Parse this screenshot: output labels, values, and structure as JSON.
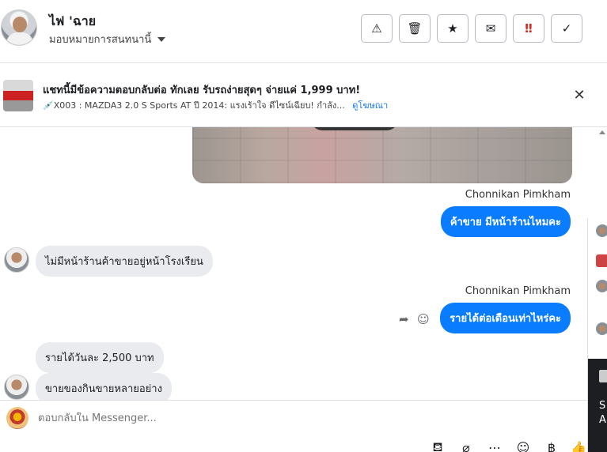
{
  "header": {
    "name": "ไฟ 'ฉาย",
    "assign_label": "มอบหมายการสนทนานี้",
    "toolbar": [
      {
        "icon": "warning-icon",
        "glyph": "⚠"
      },
      {
        "icon": "trash-icon",
        "glyph": "🗑"
      },
      {
        "icon": "star-icon",
        "glyph": "★"
      },
      {
        "icon": "mark-unread-icon",
        "glyph": "✉"
      },
      {
        "icon": "important-icon",
        "glyph": "‼"
      },
      {
        "icon": "check-icon",
        "glyph": "✓"
      }
    ]
  },
  "ad": {
    "title": "แชทนี้มีข้อความตอบกลับต่อ ทักเลย รับรถง่ายสุดๆ จ่ายแค่ 1,999 บาท!",
    "subtitle": "💉X003 : MAZDA3 2.0 S Sports AT ปี 2014: แรงเร้าใจ ดีไซน์เฉียบ! กำลัง...",
    "link": "ดูโฆษณา",
    "close_glyph": "✕"
  },
  "messages": {
    "sender1": "Chonnikan Pimkham",
    "out1": "ค้าขาย มีหน้าร้านไหมคะ",
    "in1": "ไม่มีหน้าร้านค้าขายอยู่หน้าโรงเรียน",
    "sender2": "Chonnikan Pimkham",
    "out2": "รายได้ต่อเดือนเท่าไหร่คะ",
    "in2": "รายได้วันละ 2,500 บาท",
    "in3": "ขายของกินขายหลายอย่าง",
    "reply_glyph": "➦",
    "emoji_glyph": "☺"
  },
  "sliver": {
    "letter1": "S",
    "letter2": "A"
  },
  "composer": {
    "placeholder": "ตอบกลับใน Messenger...",
    "icons": [
      {
        "icon": "saved-reply-icon",
        "glyph": "⛾"
      },
      {
        "icon": "attachment-icon",
        "glyph": "⌀"
      },
      {
        "icon": "more-icon",
        "glyph": "⋯"
      },
      {
        "icon": "emoji-icon",
        "glyph": "☺"
      },
      {
        "icon": "payment-icon",
        "glyph": "฿"
      },
      {
        "icon": "like-icon",
        "glyph": "👍"
      }
    ]
  }
}
